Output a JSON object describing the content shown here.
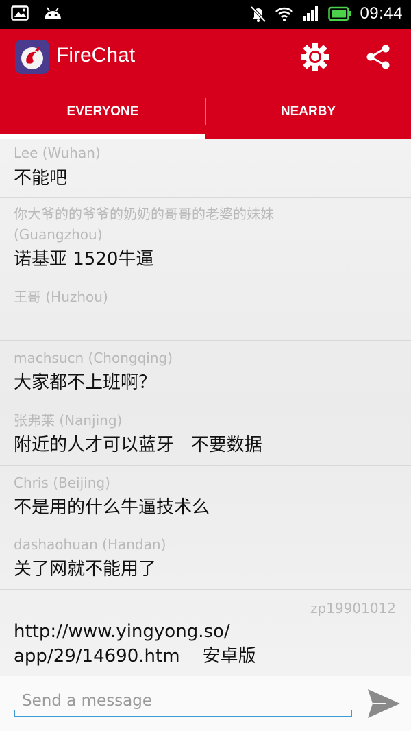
{
  "status_bar": {
    "time": "09:44",
    "icons": [
      "gallery-icon",
      "android-icon",
      "muted-bell-icon",
      "wifi-icon",
      "signal-icon",
      "battery-icon"
    ]
  },
  "app_bar": {
    "title": "FireChat",
    "icons": [
      "firechat-logo",
      "gear-icon",
      "share-icon"
    ],
    "color": "#d6001c"
  },
  "tabs": [
    {
      "label": "EVERYONE",
      "selected": true
    },
    {
      "label": "NEARBY",
      "selected": false
    }
  ],
  "messages": [
    {
      "sender": "Lee (Wuhan)",
      "text": "不能吧"
    },
    {
      "sender_line1": "你大爷的的爷爷的奶奶的哥哥的老婆的妹妹",
      "sender_line2": "(Guangzhou)",
      "text": "诺基亚 1520牛逼"
    },
    {
      "sender": "王哥 (Huzhou)",
      "text": ""
    },
    {
      "sender": "machsucn (Chongqing)",
      "text": "大家都不上班啊？"
    },
    {
      "sender": "张弗莱 (Nanjing)",
      "text": "附近的人才可以蓝牙   不要数据"
    },
    {
      "sender": "Chris (Beijing)",
      "text": "不是用的什么牛逼技术么"
    },
    {
      "sender": "dashaohuan (Handan)",
      "text": "关了网就不能用了"
    },
    {
      "sender": "zp19901012",
      "text_line1": "http://www.yingyong.so/",
      "text_line2": "app/29/14690.htm    安卓版",
      "own_message": true
    }
  ],
  "composer": {
    "placeholder": "Send a message",
    "value": "",
    "send_icon": "send-icon",
    "accent": "#3b9bd4"
  }
}
